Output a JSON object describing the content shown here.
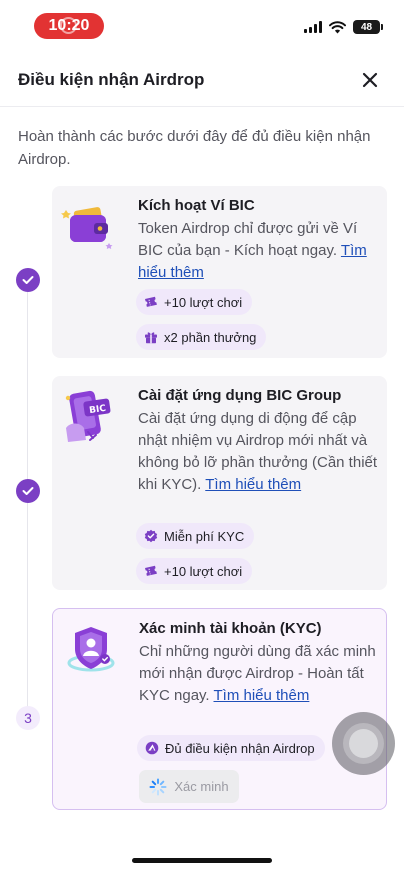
{
  "status_bar": {
    "time": "10:20",
    "battery": "48"
  },
  "header": {
    "title": "Điều kiện nhận Airdrop"
  },
  "intro": "Hoàn thành các bước dưới đây để đủ điều kiện nhận Airdrop.",
  "steps": [
    {
      "status": "done",
      "title": "Kích hoạt Ví BIC",
      "desc": "Token Airdrop chỉ được gửi về Ví BIC của bạn - Kích hoạt ngay.",
      "link": "Tìm hiểu thêm",
      "chips": [
        "+10 lượt chơi",
        "x2 phần thưởng"
      ]
    },
    {
      "status": "done",
      "title": "Cài đặt ứng dụng BIC Group",
      "desc": "Cài đặt ứng dụng di động để cập nhật nhiệm vụ Airdrop mới nhất và không bỏ lỡ phần thưởng (Cần thiết khi KYC).",
      "link": "Tìm hiểu thêm",
      "icon_text": "BIC",
      "chips": [
        "Miễn phí KYC",
        "+10 lượt chơi"
      ]
    },
    {
      "status": "current",
      "number": "3",
      "title": "Xác minh tài khoản (KYC)",
      "desc": "Chỉ những người dùng đã xác minh mới nhận được Airdrop - Hoàn tất KYC ngay.",
      "link": "Tìm hiểu thêm",
      "chips": [
        "Đủ điều kiện nhận Airdrop"
      ],
      "button": "Xác minh"
    }
  ],
  "colors": {
    "accent": "#7b3fc4",
    "chip_bg": "#f0e8fa",
    "link": "#1f4fb8",
    "card_bg": "#f5f4f7",
    "status_pill": "#e23333"
  },
  "icons": [
    "close-icon",
    "check-icon",
    "ticket-icon",
    "gift-icon",
    "verified-badge-icon",
    "shield-star-icon",
    "spinner-icon",
    "wallet-icon",
    "phone-app-icon",
    "shield-user-icon"
  ]
}
